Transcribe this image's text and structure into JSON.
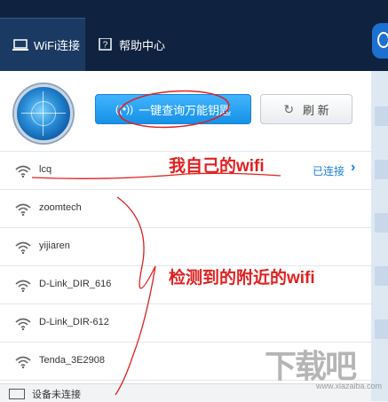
{
  "tabs": [
    {
      "label": "WiFi连接",
      "icon": "laptop-icon"
    },
    {
      "label": "帮助中心",
      "icon": "question-icon"
    }
  ],
  "toolbar": {
    "query_label": "一键查询万能钥匙",
    "refresh_label": "刷 新"
  },
  "networks": [
    {
      "ssid": "lcq",
      "status": "已连接"
    },
    {
      "ssid": "zoomtech",
      "status": ""
    },
    {
      "ssid": "yijiaren",
      "status": ""
    },
    {
      "ssid": "D-Link_DIR_616",
      "status": ""
    },
    {
      "ssid": "D-Link_DIR-612",
      "status": ""
    },
    {
      "ssid": "Tenda_3E2908",
      "status": ""
    }
  ],
  "footer": {
    "device_status": "设备未连接"
  },
  "annotations": {
    "own_wifi": "我自己的wifi",
    "nearby_wifi": "检测到的附近的wifi"
  },
  "watermark": {
    "text": "下载吧",
    "url": "www.xiazaiba.com"
  },
  "colors": {
    "accent": "#1691e6",
    "header": "#0f2340",
    "annotation": "#e02020"
  }
}
